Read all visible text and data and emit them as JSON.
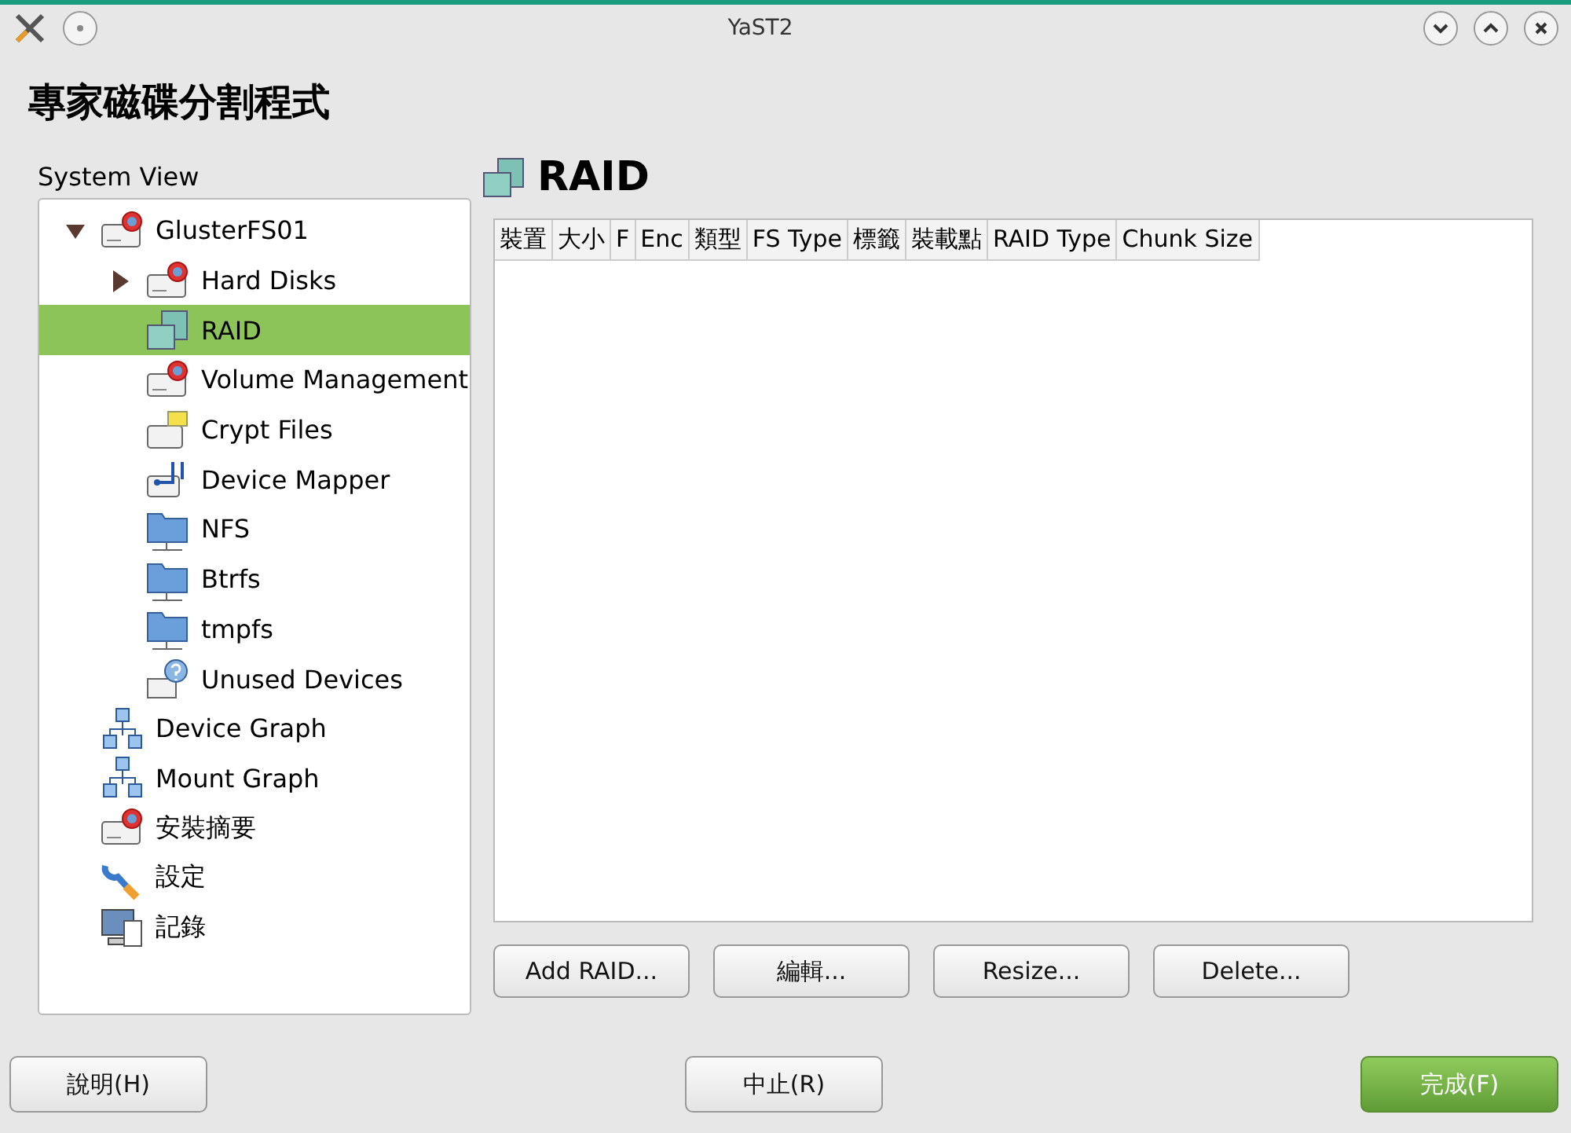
{
  "window": {
    "title": "YaST2"
  },
  "heading": "專家磁碟分割程式",
  "sidebar": {
    "label": "System View",
    "items": [
      {
        "label": "GlusterFS01",
        "kind": "disk",
        "selected": false,
        "expanded": true,
        "children": [
          {
            "label": "Hard Disks",
            "kind": "disk",
            "selected": false,
            "expanded": false
          },
          {
            "label": "RAID",
            "kind": "raid",
            "selected": true
          },
          {
            "label": "Volume Management",
            "kind": "disk",
            "selected": false
          },
          {
            "label": "Crypt Files",
            "kind": "crypt",
            "selected": false
          },
          {
            "label": "Device Mapper",
            "kind": "mapper",
            "selected": false
          },
          {
            "label": "NFS",
            "kind": "folder",
            "selected": false
          },
          {
            "label": "Btrfs",
            "kind": "folder",
            "selected": false
          },
          {
            "label": "tmpfs",
            "kind": "folder",
            "selected": false
          },
          {
            "label": "Unused Devices",
            "kind": "unused",
            "selected": false
          }
        ]
      },
      {
        "label": "Device Graph",
        "kind": "graph",
        "selected": false
      },
      {
        "label": "Mount Graph",
        "kind": "graph",
        "selected": false
      },
      {
        "label": "安裝摘要",
        "kind": "disk",
        "selected": false
      },
      {
        "label": "設定",
        "kind": "wrench",
        "selected": false
      },
      {
        "label": "記錄",
        "kind": "log",
        "selected": false
      }
    ]
  },
  "panel": {
    "title": "RAID",
    "table": {
      "columns": [
        "裝置",
        "大小",
        "F",
        "Enc",
        "類型",
        "FS Type",
        "標籤",
        "裝載點",
        "RAID Type",
        "Chunk Size"
      ]
    },
    "buttons": [
      "Add RAID...",
      "編輯...",
      "Resize...",
      "Delete..."
    ]
  },
  "footer": [
    {
      "label": "說明(H)",
      "kind": "normal"
    },
    {
      "label": "中止(R)",
      "kind": "normal"
    },
    {
      "label": "完成(F)",
      "kind": "primary"
    }
  ]
}
